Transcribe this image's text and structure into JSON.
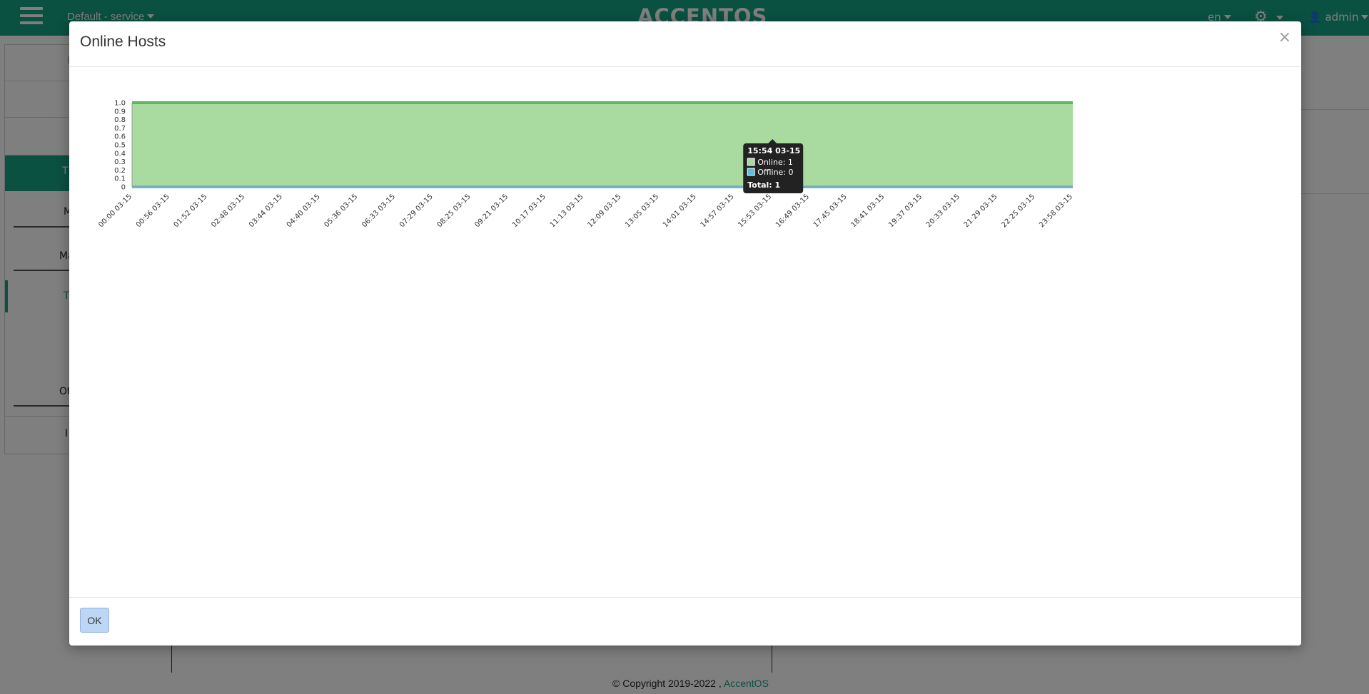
{
  "app": {
    "project_label": "Default - service",
    "logo_text": "ACCENTOS",
    "language": "en",
    "user": "admin",
    "accent_color": "#14a383"
  },
  "background": {
    "panel_rows": [
      "I",
      "M",
      "Ma",
      "T",
      "T",
      "Ot",
      "I"
    ],
    "copyright_prefix": "© Copyright 2019-2022 ,",
    "copyright_brand": "AccentOS"
  },
  "modal": {
    "title": "Online Hosts",
    "close_icon": "×",
    "ok_label": "OK"
  },
  "chart_data": {
    "type": "area",
    "x": [
      "00:00 03-15",
      "00:56 03-15",
      "01:52 03-15",
      "02:48 03-15",
      "03:44 03-15",
      "04:40 03-15",
      "05:36 03-15",
      "06:33 03-15",
      "07:29 03-15",
      "08:25 03-15",
      "09:21 03-15",
      "10:17 03-15",
      "11:13 03-15",
      "12:09 03-15",
      "13:05 03-15",
      "14:01 03-15",
      "14:57 03-15",
      "15:53 03-15",
      "16:49 03-15",
      "17:45 03-15",
      "18:41 03-15",
      "19:37 03-15",
      "20:33 03-15",
      "21:29 03-15",
      "22:25 03-15",
      "23:58 03-15"
    ],
    "series": [
      {
        "name": "Online",
        "values": [
          1,
          1,
          1,
          1,
          1,
          1,
          1,
          1,
          1,
          1,
          1,
          1,
          1,
          1,
          1,
          1,
          1,
          1,
          1,
          1,
          1,
          1,
          1,
          1,
          1,
          1
        ],
        "color": "#5cb85c",
        "fill": "#a9dba1"
      },
      {
        "name": "Offline",
        "values": [
          0,
          0,
          0,
          0,
          0,
          0,
          0,
          0,
          0,
          0,
          0,
          0,
          0,
          0,
          0,
          0,
          0,
          0,
          0,
          0,
          0,
          0,
          0,
          0,
          0,
          0
        ],
        "color": "#5bc0de"
      }
    ],
    "y_ticks": [
      "0",
      "0.1",
      "0.2",
      "0.3",
      "0.4",
      "0.5",
      "0.6",
      "0.7",
      "0.8",
      "0.9",
      "1.0"
    ],
    "ylim": [
      0,
      1
    ],
    "grid": true,
    "tooltip": {
      "title": "15:54 03-15",
      "lines": [
        "Online: 1",
        "Offline: 0"
      ],
      "total": "Total: 1",
      "x_value": "15:54 03-15"
    }
  }
}
